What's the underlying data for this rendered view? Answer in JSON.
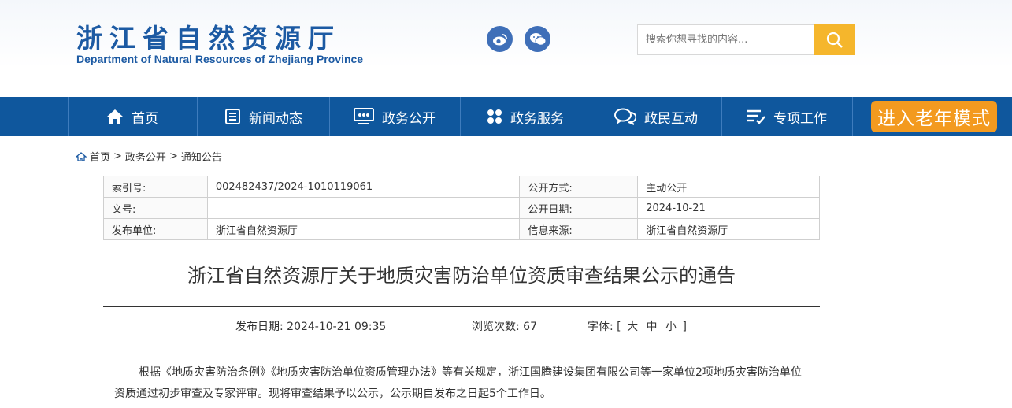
{
  "header": {
    "title_cn": "浙江省自然资源厅",
    "title_en": "Department of Natural Resources of Zhejiang Province",
    "social": [
      {
        "icon": "weibo-icon"
      },
      {
        "icon": "wechat-icon"
      }
    ],
    "search": {
      "placeholder": "搜索你想寻找的内容..."
    },
    "colors": {
      "brand": "#1c5aa3",
      "nav": "#0f579d",
      "accent": "#f5b62c",
      "elder": "#f39a1f"
    }
  },
  "nav": {
    "items": [
      {
        "label": "首页",
        "icon": "home-icon"
      },
      {
        "label": "新闻动态",
        "icon": "news-icon"
      },
      {
        "label": "政务公开",
        "icon": "gov-open-icon"
      },
      {
        "label": "政务服务",
        "icon": "service-grid-icon"
      },
      {
        "label": "政民互动",
        "icon": "chat-icon"
      },
      {
        "label": "专项工作",
        "icon": "list-check-icon"
      }
    ],
    "elder_mode": "进入老年模式"
  },
  "breadcrumb": {
    "home": "首页",
    "level1": "政务公开",
    "level2": "通知公告",
    "sep": ">"
  },
  "meta": {
    "index_label": "索引号:",
    "index_value": "002482437/2024-1010119061",
    "open_mode_label": "公开方式:",
    "open_mode_value": "主动公开",
    "doc_no_label": "文号:",
    "doc_no_value": "",
    "open_date_label": "公开日期:",
    "open_date_value": "2024-10-21",
    "issuer_label": "发布单位:",
    "issuer_value": "浙江省自然资源厅",
    "source_label": "信息来源:",
    "source_value": "浙江省自然资源厅"
  },
  "article": {
    "title": "浙江省自然资源厅关于地质灾害防治单位资质审查结果公示的通告",
    "publish_date": "发布日期: 2024-10-21 09:35",
    "views": "浏览次数: 67",
    "font_label": "字体: [",
    "font_large": "大",
    "font_medium": "中",
    "font_small": "小",
    "font_end": "]",
    "body_p1": "根据《地质灾害防治条例》《地质灾害防治单位资质管理办法》等有关规定，浙江国腾建设集团有限公司等一家单位2项地质灾害防治单位资质通过初步审查及专家评审。现将审查结果予以公示，公示期自发布之日起5个工作日。"
  }
}
